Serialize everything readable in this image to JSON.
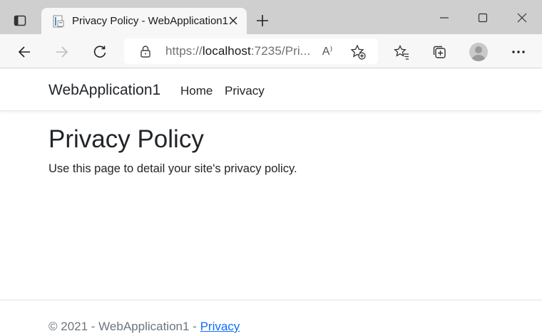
{
  "browser": {
    "tab": {
      "title": "Privacy Policy - WebApplication1"
    },
    "address": {
      "prefix": "https://",
      "host": "localhost",
      "rest": ":7235/Pri..."
    },
    "read_aloud_glyph": "A⁾",
    "icons": [
      "sidebar-tabs-icon",
      "page-favicon-icon",
      "close-icon",
      "plus-icon",
      "minimize-icon",
      "maximize-icon",
      "window-close-icon",
      "back-arrow-icon",
      "forward-arrow-icon",
      "refresh-icon",
      "lock-icon",
      "read-aloud-icon",
      "add-favorite-icon",
      "favorites-icon",
      "collections-icon",
      "profile-avatar-icon",
      "more-icon"
    ]
  },
  "site": {
    "brand": "WebApplication1",
    "nav": {
      "home": "Home",
      "privacy": "Privacy"
    },
    "heading": "Privacy Policy",
    "body": "Use this page to detail your site's privacy policy.",
    "footer": {
      "text": "© 2021 - WebApplication1 - ",
      "link": "Privacy"
    }
  },
  "colors": {
    "titlebar": "#cfcfcf",
    "toolbar": "#f7f7f7",
    "link": "#0d6efd",
    "text": "#212529",
    "muted": "#6c757d"
  }
}
